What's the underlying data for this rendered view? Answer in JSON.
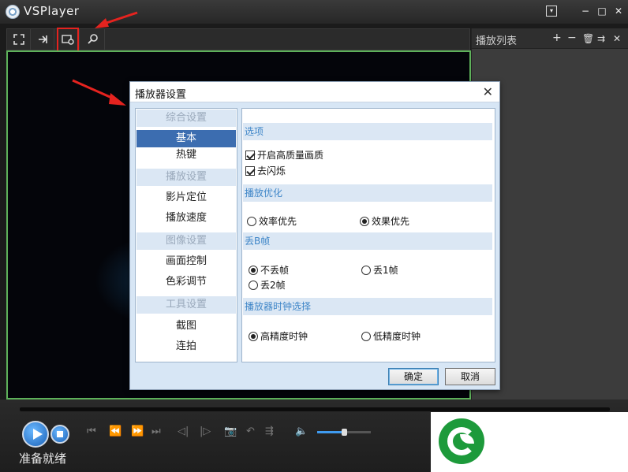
{
  "app": {
    "title": "VSPlayer"
  },
  "window_controls": {
    "menu": "⧉",
    "minimize": "−",
    "maximize": "□",
    "close": "✕"
  },
  "toolbar": {
    "icons": [
      "fullscreen-icon",
      "pin-icon",
      "settings-icon",
      "search-icon"
    ],
    "highlighted": "settings-icon"
  },
  "playlist": {
    "title": "播放列表",
    "actions": [
      "add-icon",
      "remove-icon",
      "trash-icon",
      "move-icon",
      "close-icon"
    ]
  },
  "player": {
    "status": "准备就绪",
    "volume_level": 0.5,
    "controls": [
      "prev-icon",
      "rewind-icon",
      "forward-icon",
      "next-icon",
      "step-back-icon",
      "step-forward-icon",
      "camera-icon",
      "repeat-icon",
      "playlist-mode-icon",
      "volume-icon"
    ]
  },
  "dialog": {
    "title": "播放器设置",
    "close": "✕",
    "nav": [
      {
        "category": "综合设置",
        "items": [
          "基本",
          "热键"
        ]
      },
      {
        "category": "播放设置",
        "items": [
          "影片定位",
          "播放速度"
        ]
      },
      {
        "category": "图像设置",
        "items": [
          "画面控制",
          "色彩调节"
        ]
      },
      {
        "category": "工具设置",
        "items": [
          "截图",
          "连拍"
        ]
      }
    ],
    "selected_item": "基本",
    "sections": {
      "options": {
        "title": "选项",
        "items": [
          {
            "label": "开启高质量画质",
            "checked": true
          },
          {
            "label": "去闪烁",
            "checked": true
          }
        ]
      },
      "play_opt": {
        "title": "播放优化",
        "items": [
          {
            "label": "效率优先",
            "selected": false
          },
          {
            "label": "效果优先",
            "selected": true
          }
        ]
      },
      "drop_b": {
        "title": "丢B帧",
        "items": [
          {
            "label": "不丢帧",
            "selected": true
          },
          {
            "label": "丢1帧",
            "selected": false
          },
          {
            "label": "丢2帧",
            "selected": false
          }
        ]
      },
      "clock": {
        "title": "播放器时钟选择",
        "items": [
          {
            "label": "高精度时钟",
            "selected": true
          },
          {
            "label": "低精度时钟",
            "selected": false
          }
        ]
      }
    },
    "buttons": {
      "ok": "确定",
      "cancel": "取消"
    }
  },
  "colors": {
    "accent_green": "#5eb15a",
    "highlight_red": "#e5231f",
    "selection_blue": "#3c6db0",
    "watermark_green": "#1d9a3b"
  }
}
